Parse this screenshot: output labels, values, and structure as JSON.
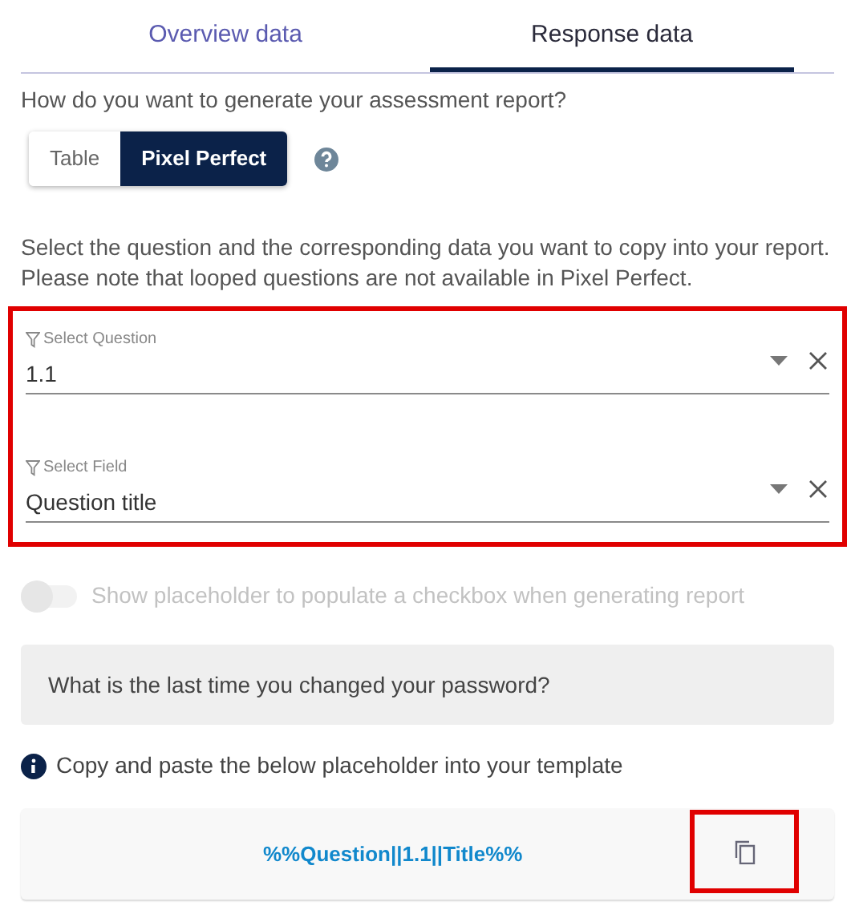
{
  "tabs": [
    {
      "label": "Overview data",
      "selected": false
    },
    {
      "label": "Response data",
      "selected": true
    }
  ],
  "mode_question": "How do you want to generate your assessment report?",
  "mode_options": [
    {
      "label": "Table",
      "selected": false
    },
    {
      "label": "Pixel Perfect",
      "selected": true
    }
  ],
  "instructions": "Select the question and the corresponding data you want to copy into your report. Please note that looped questions are not available in Pixel Perfect.",
  "selectors": {
    "highlighted": true,
    "fields": [
      {
        "label": "Select Question",
        "value": "1.1"
      },
      {
        "label": "Select Field",
        "value": "Question title"
      }
    ]
  },
  "checkbox_toggle": {
    "label": "Show placeholder to populate a checkbox when generating report",
    "on": false,
    "disabled": true
  },
  "question_preview": "What is the last time you changed your password?",
  "info": "Copy and paste the below placeholder into your template",
  "placeholder": {
    "value": "%%Question||1.1||Title%%",
    "copy_highlighted": true
  }
}
